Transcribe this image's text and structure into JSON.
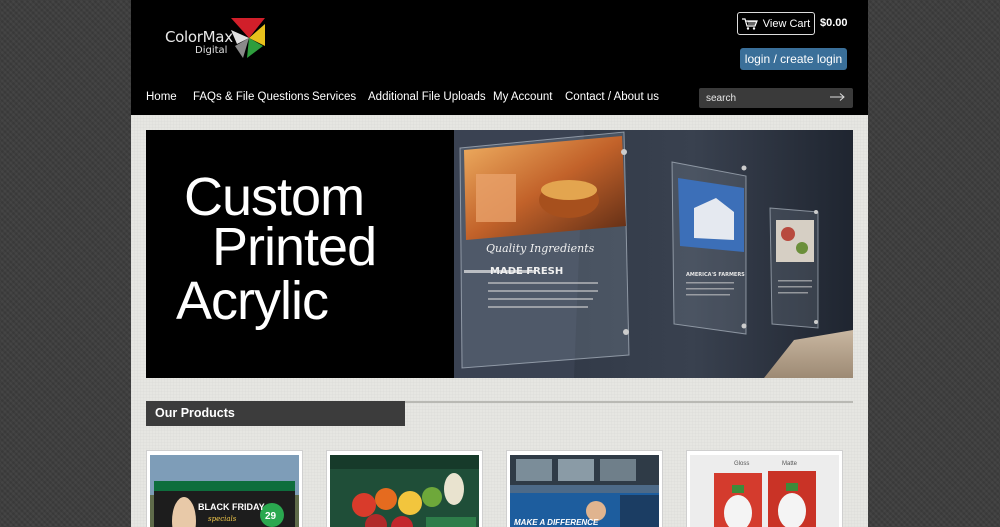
{
  "brand": {
    "name": "ColorMax",
    "sub": "Digital",
    "colors": [
      "#d11f2a",
      "#e8c11c",
      "#2e9e3d",
      "#8a8a8a"
    ]
  },
  "header": {
    "cart_label": "View Cart",
    "cart_total": "$0.00",
    "login_label": "login / create login"
  },
  "nav": {
    "items": [
      "Home",
      "FAQs & File Questions",
      "Services",
      "Additional File Uploads",
      "My Account",
      "Contact / About us"
    ]
  },
  "search": {
    "placeholder": "search"
  },
  "banner": {
    "line1": "Custom",
    "line2": "Printed",
    "line3": "Acrylic",
    "sign1_title": "Quality Ingredients",
    "sign1_sub": "MADE FRESH",
    "sign2_title": "AMERICA'S FARMERS"
  },
  "products": {
    "heading": "Our Products",
    "card1_text": "BLACK FRIDAY",
    "card1_sub": "specials",
    "card1_num": "29",
    "card3_text": "MAKE A DIFFERENCE",
    "card4_label_left": "Gloss",
    "card4_label_right": "Matte"
  },
  "colors": {
    "login_button": "#3a6f99",
    "header_bg": "#000000",
    "section_tab": "#3c3c3c"
  }
}
